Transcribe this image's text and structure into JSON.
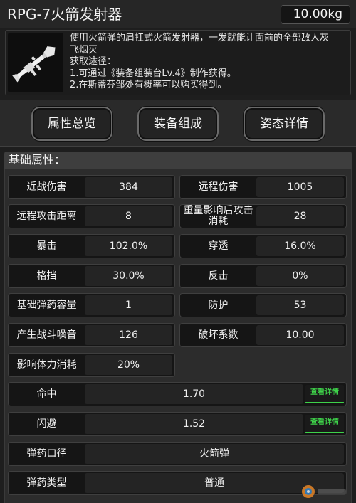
{
  "item": {
    "name": "RPG-7火箭发射器",
    "weight": "10.00kg",
    "description": [
      "使用火箭弹的肩扛式火箭发射器，一发就能让面前的全部敌人灰",
      "飞烟灭",
      "获取途径：",
      "1.可通过《装备组装台Lv.4》制作获得。",
      "2.在斯蒂芬邹处有概率可以购买得到。"
    ]
  },
  "tabs": [
    {
      "label": "属性总览"
    },
    {
      "label": "装备组成"
    },
    {
      "label": "姿态详情"
    }
  ],
  "section": {
    "title": "基础属性："
  },
  "stats": {
    "melee_damage": {
      "label": "近战伤害",
      "value": "384"
    },
    "ranged_damage": {
      "label": "远程伤害",
      "value": "1005"
    },
    "ranged_distance": {
      "label": "远程攻击距离",
      "value": "8"
    },
    "weight_cost": {
      "label": "重量影响后攻击消耗",
      "value": "28"
    },
    "crit": {
      "label": "暴击",
      "value": "102.0%"
    },
    "penetration": {
      "label": "穿透",
      "value": "16.0%"
    },
    "block": {
      "label": "格挡",
      "value": "30.0%"
    },
    "counter": {
      "label": "反击",
      "value": "0%"
    },
    "ammo_capacity": {
      "label": "基础弹药容量",
      "value": "1"
    },
    "defense": {
      "label": "防护",
      "value": "53"
    },
    "noise": {
      "label": "产生战斗噪音",
      "value": "126"
    },
    "destruction": {
      "label": "破坏系数",
      "value": "10.00"
    },
    "stamina": {
      "label": "影响体力消耗",
      "value": "20%"
    },
    "accuracy": {
      "label": "命中",
      "value": "1.70",
      "link": "查看详情"
    },
    "evasion": {
      "label": "闪避",
      "value": "1.52",
      "link": "查看详情"
    },
    "caliber": {
      "label": "弹药口径",
      "value": "火箭弹"
    },
    "ammo_type": {
      "label": "弹药类型",
      "value": "普通"
    }
  },
  "colors": {
    "link_green": "#3ed24a",
    "panel_dark": "#151515",
    "value_bg": "#242424"
  },
  "icons": {
    "weapon": "rpg7-launcher-icon",
    "watermark": "site-logo-watermark"
  }
}
